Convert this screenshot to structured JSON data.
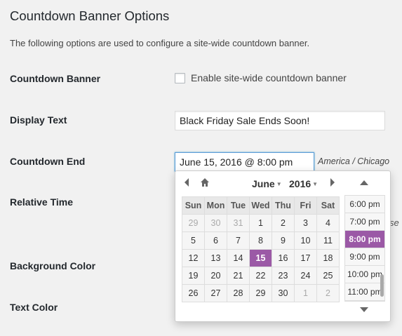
{
  "page": {
    "title": "Countdown Banner Options",
    "intro": "The following options are used to configure a site-wide countdown banner."
  },
  "fields": {
    "countdown_banner": {
      "label": "Countdown Banner",
      "checkbox_label": "Enable site-wide countdown banner",
      "checked": false
    },
    "display_text": {
      "label": "Display Text",
      "value": "Black Friday Sale Ends Soon!"
    },
    "countdown_end": {
      "label": "Countdown End",
      "value": "June 15, 2016 @ 8:00 pm",
      "timezone": "America / Chicago"
    },
    "relative_time": {
      "label": "Relative Time",
      "partial_text": "se"
    },
    "background_color": {
      "label": "Background Color"
    },
    "text_color": {
      "label": "Text Color"
    }
  },
  "picker": {
    "prev_icon": "chevron-left-icon",
    "home_icon": "home-icon",
    "next_icon": "chevron-right-icon",
    "month": "June",
    "year": "2016",
    "weekdays": [
      "Sun",
      "Mon",
      "Tue",
      "Wed",
      "Thu",
      "Fri",
      "Sat"
    ],
    "weeks": [
      [
        {
          "d": "29",
          "other": true
        },
        {
          "d": "30",
          "other": true
        },
        {
          "d": "31",
          "other": true
        },
        {
          "d": "1"
        },
        {
          "d": "2"
        },
        {
          "d": "3"
        },
        {
          "d": "4"
        }
      ],
      [
        {
          "d": "5"
        },
        {
          "d": "6"
        },
        {
          "d": "7"
        },
        {
          "d": "8"
        },
        {
          "d": "9"
        },
        {
          "d": "10"
        },
        {
          "d": "11"
        }
      ],
      [
        {
          "d": "12"
        },
        {
          "d": "13"
        },
        {
          "d": "14"
        },
        {
          "d": "15",
          "selected": true
        },
        {
          "d": "16"
        },
        {
          "d": "17"
        },
        {
          "d": "18"
        }
      ],
      [
        {
          "d": "19"
        },
        {
          "d": "20"
        },
        {
          "d": "21"
        },
        {
          "d": "22"
        },
        {
          "d": "23"
        },
        {
          "d": "24"
        },
        {
          "d": "25"
        }
      ],
      [
        {
          "d": "26"
        },
        {
          "d": "27"
        },
        {
          "d": "28"
        },
        {
          "d": "29"
        },
        {
          "d": "30"
        },
        {
          "d": "1",
          "other": true
        },
        {
          "d": "2",
          "other": true
        }
      ]
    ],
    "times": [
      {
        "t": "6:00 pm"
      },
      {
        "t": "7:00 pm"
      },
      {
        "t": "8:00 pm",
        "selected": true
      },
      {
        "t": "9:00 pm"
      },
      {
        "t": "10:00 pm"
      },
      {
        "t": "11:00 pm"
      }
    ],
    "selected_color": "#9b59a6"
  }
}
